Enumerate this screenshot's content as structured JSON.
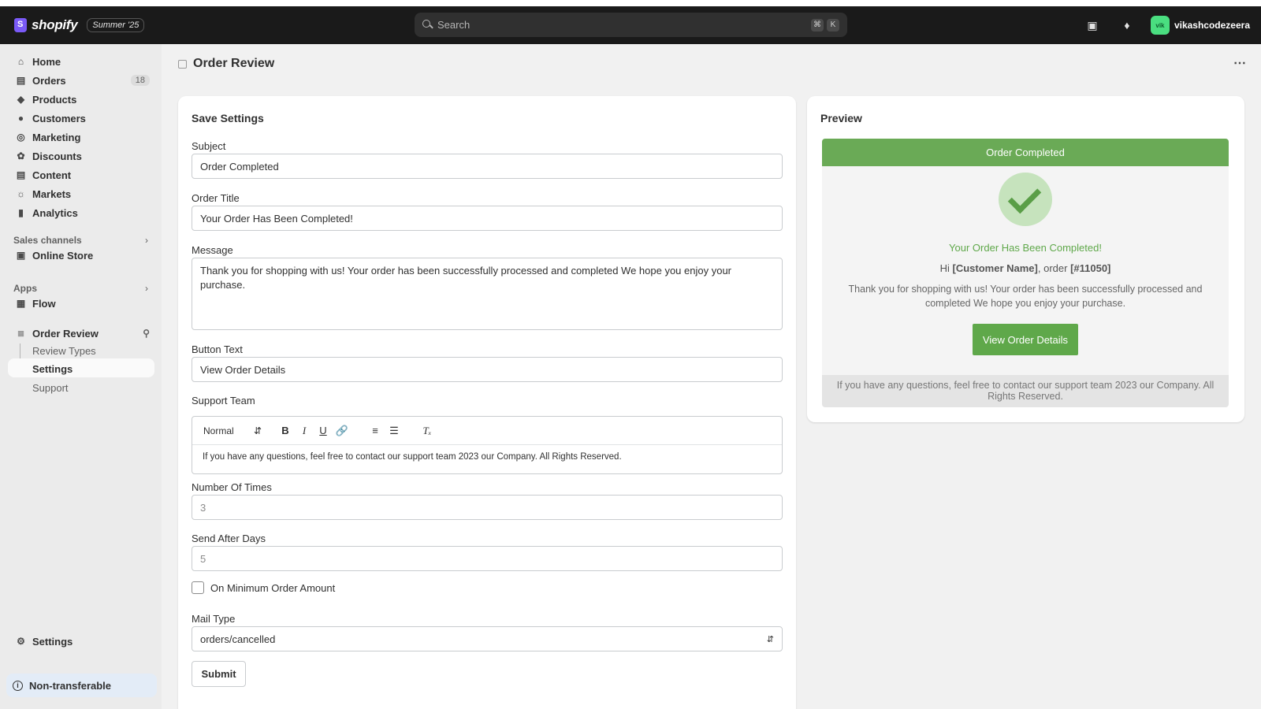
{
  "topbar": {
    "brand": "shopify",
    "edition_badge": "Summer '25",
    "search_placeholder": "Search",
    "shortcut_keys": [
      "⌘",
      "K"
    ],
    "username": "vikashcodezeera",
    "avatar_initials": "vik"
  },
  "sidebar": {
    "items": [
      {
        "label": "Home",
        "icon": "home-icon"
      },
      {
        "label": "Orders",
        "icon": "orders-icon",
        "count": "18"
      },
      {
        "label": "Products",
        "icon": "tag-icon"
      },
      {
        "label": "Customers",
        "icon": "person-icon"
      },
      {
        "label": "Marketing",
        "icon": "target-icon"
      },
      {
        "label": "Discounts",
        "icon": "discount-icon"
      },
      {
        "label": "Content",
        "icon": "content-icon"
      },
      {
        "label": "Markets",
        "icon": "globe-icon"
      },
      {
        "label": "Analytics",
        "icon": "bar-chart-icon"
      }
    ],
    "sales_channels_label": "Sales channels",
    "online_store": "Online Store",
    "apps_label": "Apps",
    "flow": "Flow",
    "app_name": "Order Review",
    "app_subitems": [
      "Review Types",
      "Settings",
      "Support"
    ],
    "settings": "Settings",
    "non_transferable": "Non-transferable"
  },
  "page": {
    "title": "Order Review"
  },
  "form": {
    "card_title": "Save Settings",
    "subject_label": "Subject",
    "subject_value": "Order Completed",
    "order_title_label": "Order Title",
    "order_title_value": "Your Order Has Been Completed!",
    "message_label": "Message",
    "message_value": "Thank you for shopping with us! Your order has been successfully processed and completed We hope you enjoy your purchase.",
    "button_text_label": "Button Text",
    "button_text_value": "View Order Details",
    "support_team_label": "Support Team",
    "editor_format": "Normal",
    "support_team_value": "If you have any questions, feel free to contact our support team 2023 our Company. All Rights Reserved.",
    "number_of_times_label": "Number Of Times",
    "number_of_times_value": "3",
    "send_after_days_label": "Send After Days",
    "send_after_days_value": "5",
    "min_order_label": "On Minimum Order Amount",
    "min_order_checked": false,
    "mail_type_label": "Mail Type",
    "mail_type_value": "orders/cancelled",
    "submit_label": "Submit"
  },
  "preview": {
    "card_title": "Preview",
    "header": "Order Completed",
    "title": "Your Order Has Been Completed!",
    "hi": "Hi",
    "customer_name": "[Customer Name]",
    "order_text": ", order",
    "order_number": "[#11050]",
    "message": "Thank you for shopping with us! Your order has been successfully processed and completed We hope you enjoy your purchase.",
    "button": "View Order Details",
    "footer": "If you have any questions, feel free to contact our support team 2023 our Company. All Rights Reserved.",
    "accent_color": "#6aaa56"
  }
}
